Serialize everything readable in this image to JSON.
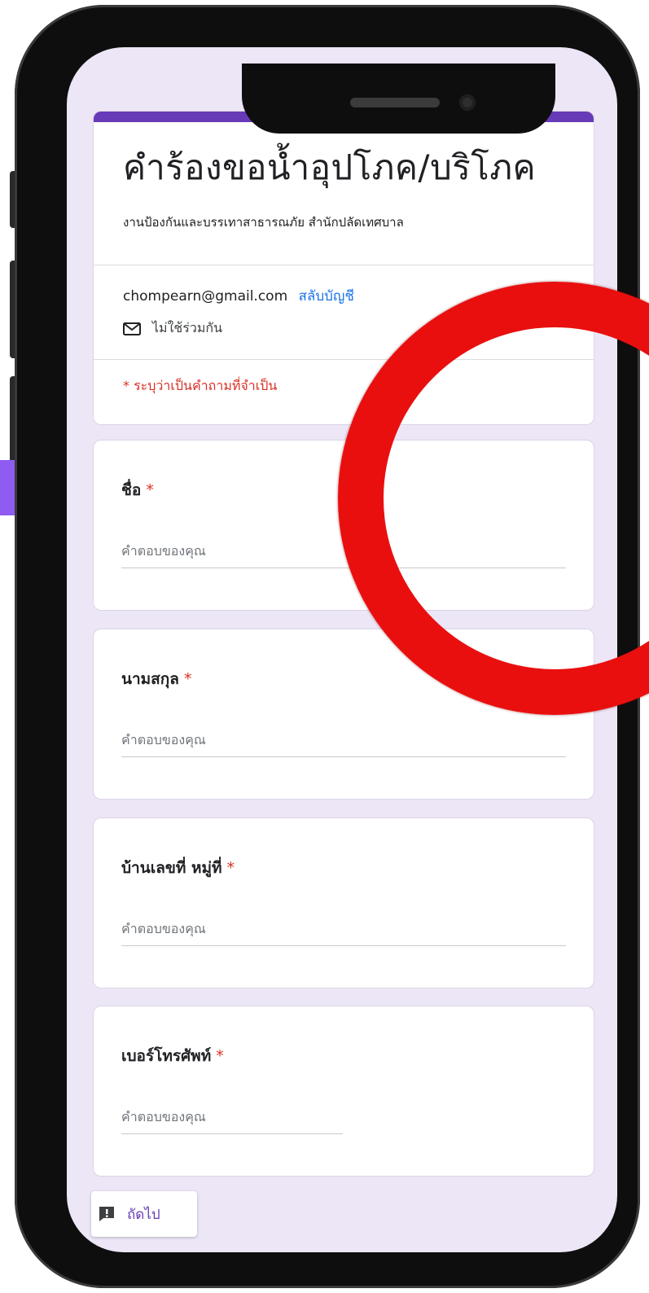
{
  "form": {
    "title": "คำร้องขอน้ำอุปโภค/บริโภค",
    "description": "งานป้องกันและบรรเทาสาธารณภัย สำนักปลัดเทศบาล",
    "account_email": "chompearn@gmail.com",
    "switch_account": "สลับบัญชี",
    "not_shared": "ไม่ใช้ร่วมกัน",
    "required_note": "* ระบุว่าเป็นคำถามที่จำเป็น",
    "accent_color": "#673ab7",
    "required_color": "#d93025"
  },
  "questions": [
    {
      "label": "ชื่อ",
      "required": "*",
      "placeholder": "คำตอบของคุณ"
    },
    {
      "label": "นามสกุล",
      "required": "*",
      "placeholder": "คำตอบของคุณ"
    },
    {
      "label": "บ้านเลขที่ หมู่ที่",
      "required": "*",
      "placeholder": "คำตอบของคุณ"
    },
    {
      "label": "เบอร์โทรศัพท์",
      "required": "*",
      "placeholder": "คำตอบของคุณ"
    }
  ],
  "footer": {
    "next_label": "ถัดไป",
    "report_icon": "report-icon"
  },
  "overlay": {
    "annotation": "red-circle",
    "color": "#e90f0f"
  }
}
